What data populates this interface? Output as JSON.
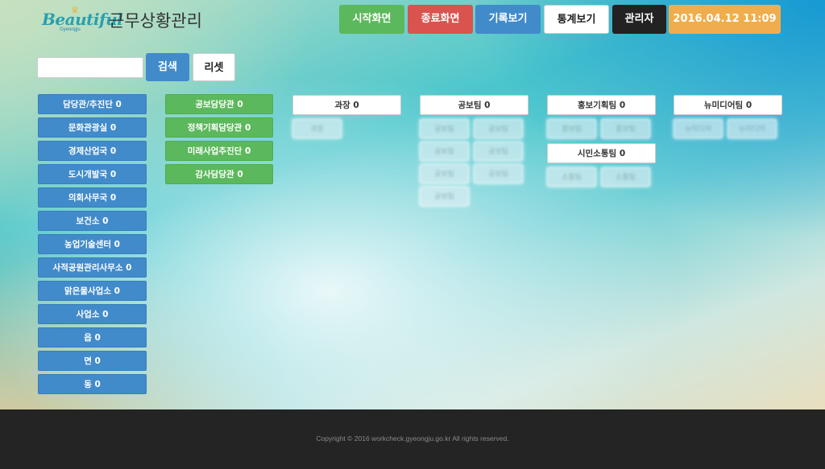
{
  "header": {
    "logo_text": "Beautiful",
    "logo_sub": "Gyeongju",
    "title": "근무상황관리",
    "nav": {
      "start": "시작화면",
      "end": "종료화면",
      "log": "기록보기",
      "stats": "통계보기",
      "admin": "관리자",
      "datetime": "2016.04.12 11:09"
    }
  },
  "search": {
    "value": "",
    "search_label": "검색",
    "reset_label": "리셋"
  },
  "departments": [
    {
      "label": "담당관/추진단 0"
    },
    {
      "label": "문화관광실 0"
    },
    {
      "label": "경제산업국 0"
    },
    {
      "label": "도시개발국 0"
    },
    {
      "label": "의회사무국 0"
    },
    {
      "label": "보건소 0"
    },
    {
      "label": "농업기술센터 0"
    },
    {
      "label": "사적공원관리사무소 0"
    },
    {
      "label": "맑은물사업소 0"
    },
    {
      "label": "사업소 0"
    },
    {
      "label": "읍 0"
    },
    {
      "label": "면 0"
    },
    {
      "label": "동 0"
    }
  ],
  "offices": [
    {
      "label": "공보담당관 0"
    },
    {
      "label": "정책기획담당관 0"
    },
    {
      "label": "미래사업추진단 0"
    },
    {
      "label": "감사담당관 0"
    }
  ],
  "teams": {
    "chief": {
      "label": "과장 0",
      "members": [
        "과장"
      ]
    },
    "pr": {
      "label": "공보팀 0",
      "members": [
        "공보팀",
        "공보팀",
        "공보팀",
        "공보팀",
        "공보팀",
        "공보팀",
        "공보팀"
      ]
    },
    "promo": {
      "label": "홍보기획팀 0",
      "members": [
        "홍보팀",
        "홍보팀"
      ]
    },
    "citizen": {
      "label": "시민소통팀 0",
      "members": [
        "소통팀",
        "소통팀"
      ]
    },
    "media": {
      "label": "뉴미디어팀 0",
      "members": [
        "뉴미디어",
        "뉴미디어"
      ]
    }
  },
  "footer": {
    "copyright": "Copyright © 2016 workcheck.gyeongju.go.kr All rights reserved."
  },
  "colors": {
    "primary": "#428bca",
    "success": "#5cb85c",
    "danger": "#d9534f",
    "warning": "#f0ad4e",
    "dark": "#222222"
  }
}
